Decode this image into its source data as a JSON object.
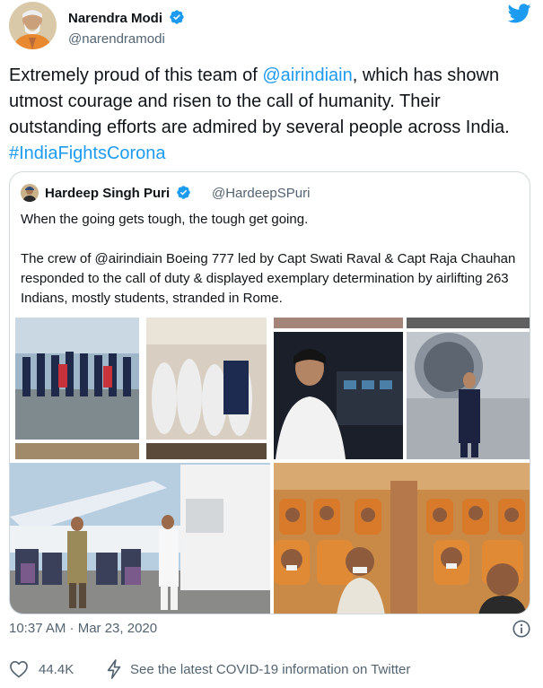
{
  "tweet": {
    "author": {
      "name": "Narendra Modi",
      "handle": "@narendramodi",
      "verified_icon": "verified-badge-icon",
      "avatar": "avatar"
    },
    "platform_icon": "twitter-bird-icon",
    "text": {
      "part1": "Extremely proud of this team of ",
      "mention": "@airindiain",
      "part2": ", which has shown utmost courage and risen to the call of humanity. Their outstanding efforts are admired by several people across India. ",
      "hashtag": "#IndiaFightsCorona"
    },
    "timestamp": "10:37 AM · Mar 23, 2020",
    "likes": "44.4K",
    "covid_notice": "See the latest COVID-19 information on Twitter",
    "colors": {
      "link": "#1d9bf0",
      "muted": "#536471",
      "text": "#0f1419",
      "border": "#cfd9de"
    }
  },
  "quoted": {
    "author": {
      "name": "Hardeep Singh Puri",
      "handle": "@HardeepSPuri"
    },
    "text": "When the going gets tough, the tough get going.\n\nThe crew of @airindiain Boeing 777 led by Capt Swati Raval & Capt Raja Chauhan responded to the call of duty & displayed exemplary determination by airlifting 263 Indians, mostly students, stranded in Rome."
  }
}
